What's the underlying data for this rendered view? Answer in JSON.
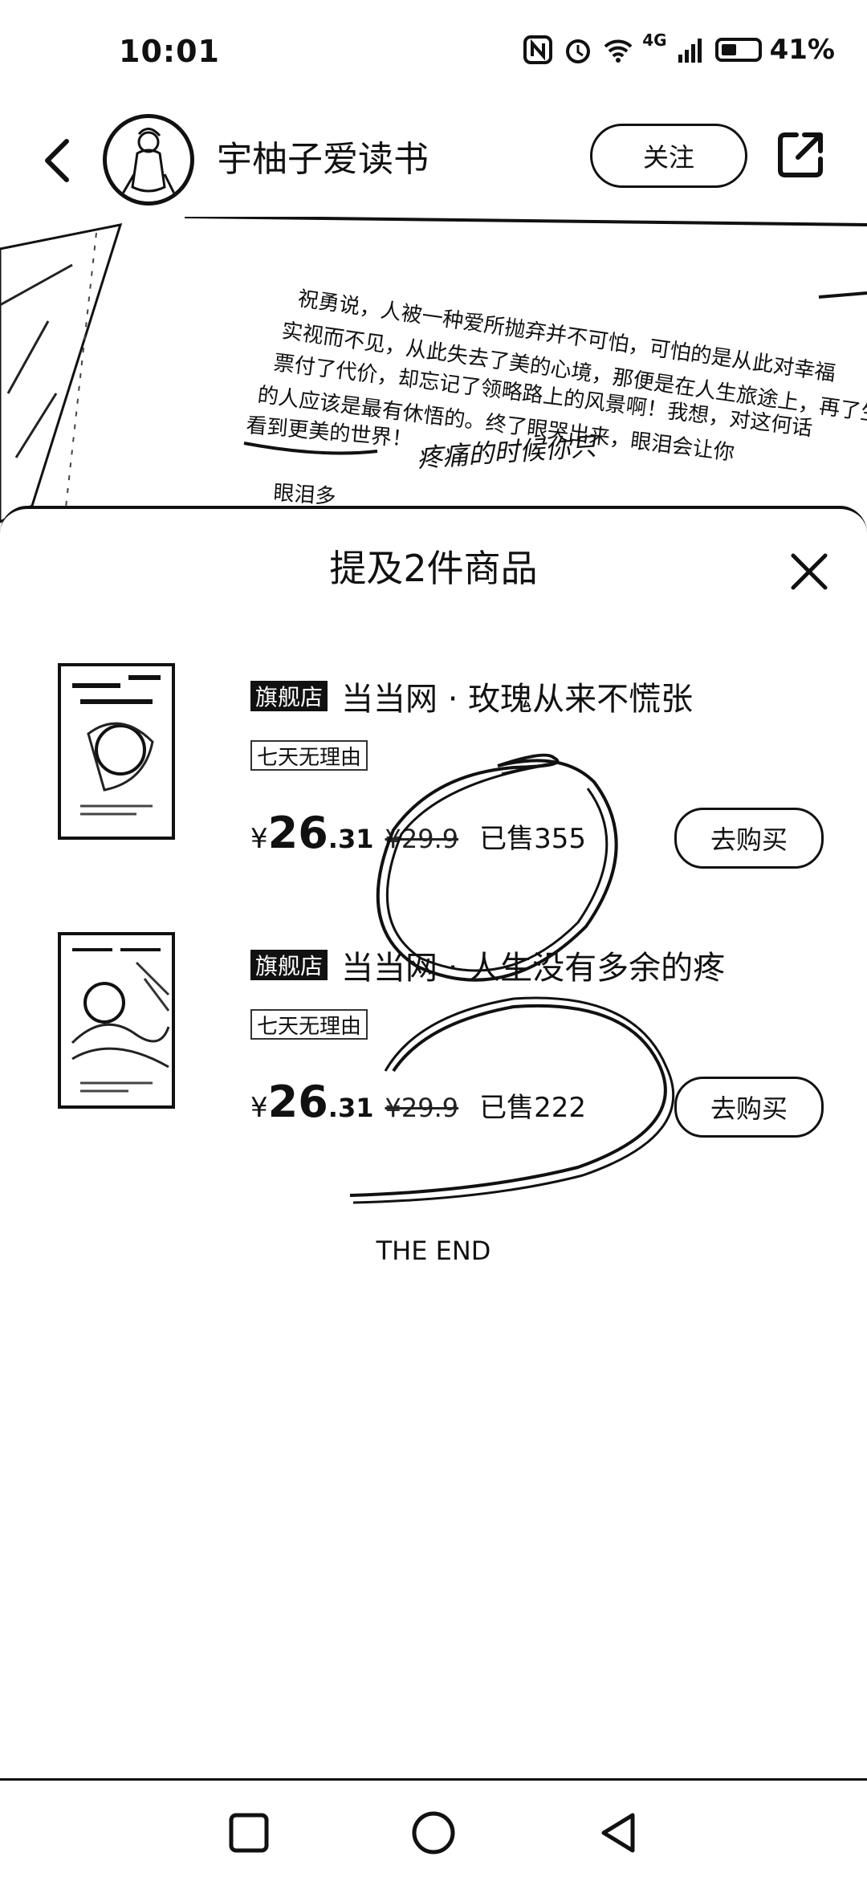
{
  "status_bar": {
    "time": "10:01",
    "network": "4G",
    "battery": "41%"
  },
  "header": {
    "back_icon": "chevron-left-icon",
    "profile_name": "宇柚子爱读书",
    "follow_label": "关注",
    "share_icon": "share-external-icon"
  },
  "hero_text": {
    "lines": [
      "祝勇说，人被一种爱所抛弃并不可怕，可怕的是从此对幸福",
      "实视而不见，从此失去了美的心境，那便是在人生旅途上，再了生",
      "票付了代价，却忘记了领略路上的风景啊！我想，对这何话",
      "的人应该是最有休悟的。终了眼哭出来，眼泪会让你",
      "看到更美的世界！",
      "疼痛的时候你只",
      "眼泪多"
    ]
  },
  "sheet": {
    "title": "提及2件商品",
    "close_icon": "close-icon",
    "products": [
      {
        "badge": "旗舰店",
        "title": "当当网 · 玫瑰从来不慌张",
        "tag": "七天无理由",
        "currency": "¥",
        "price_int": "26",
        "price_dec": ".31",
        "orig_price": "¥29.9",
        "sold": "已售355",
        "buy_label": "去购买"
      },
      {
        "badge": "旗舰店",
        "title": "当当网 · 人生没有多余的疼",
        "tag": "七天无理由",
        "currency": "¥",
        "price_int": "26",
        "price_dec": ".31",
        "orig_price": "¥29.9",
        "sold": "已售222",
        "buy_label": "去购买"
      }
    ],
    "end_text": "THE END"
  },
  "nav": {
    "recent_icon": "square-recent-apps-icon",
    "home_icon": "circle-home-icon",
    "back_icon": "triangle-back-icon"
  }
}
